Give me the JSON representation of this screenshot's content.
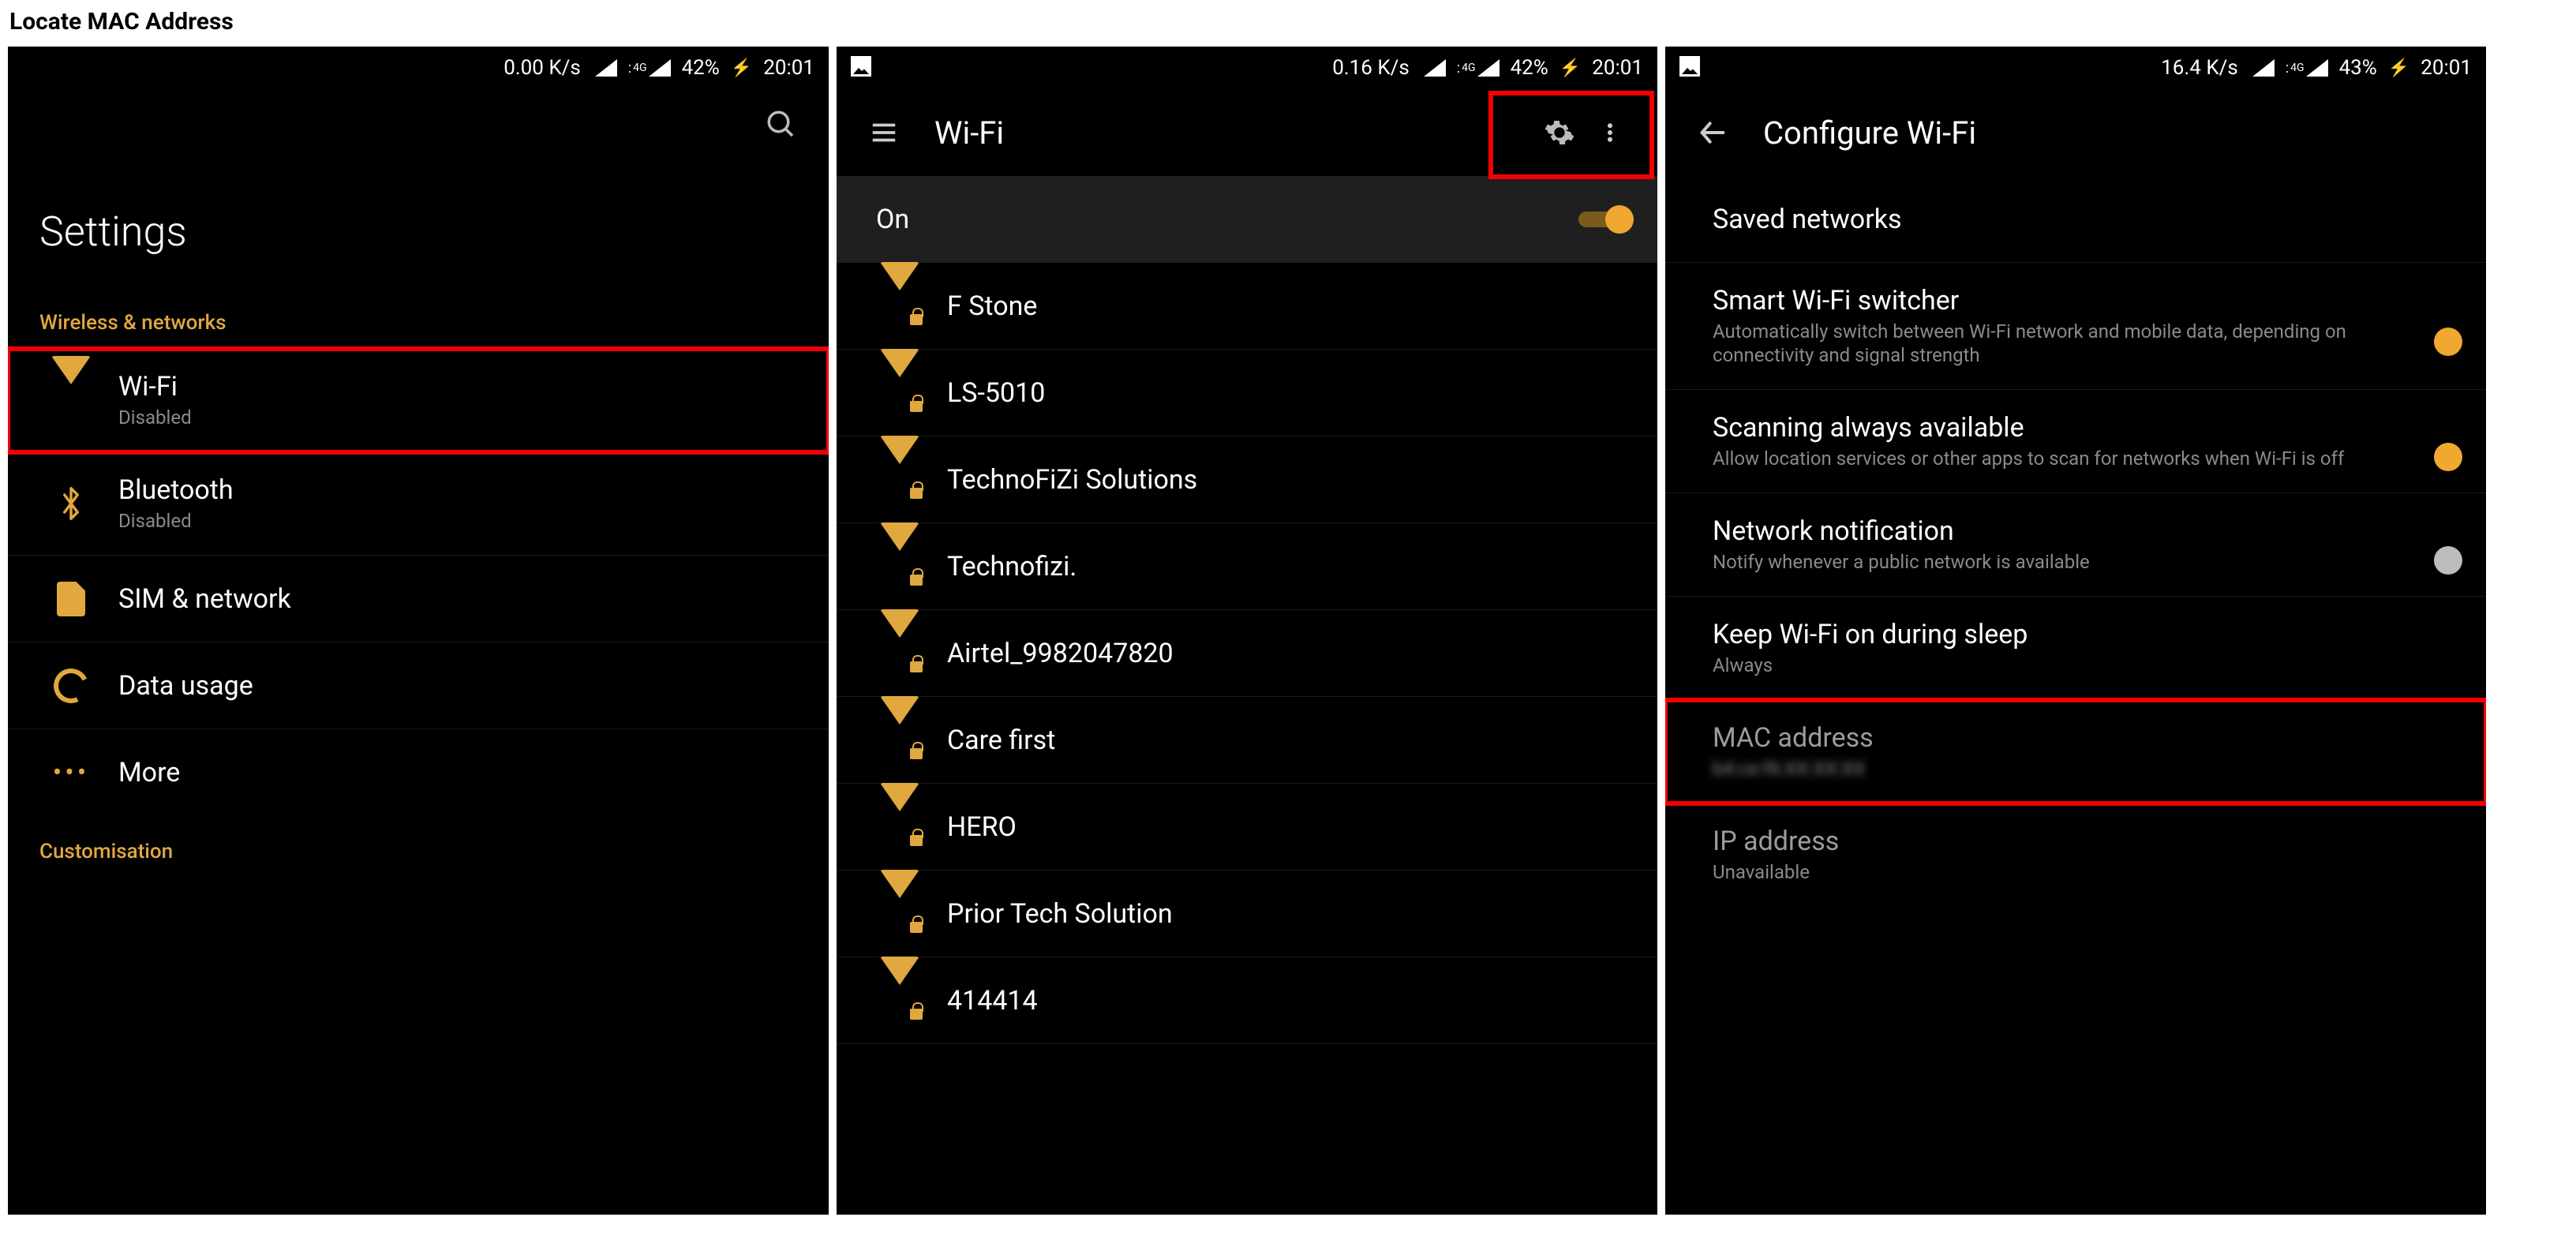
{
  "page_heading": "Locate MAC Address",
  "accent_color": "#e0a83e",
  "screens": {
    "settings": {
      "status": {
        "speed": "0.00 K/s",
        "net_tag": "4G",
        "battery": "42%",
        "time": "20:01"
      },
      "title": "Settings",
      "section_wireless": "Wireless & networks",
      "items": [
        {
          "label": "Wi-Fi",
          "sub": "Disabled",
          "icon": "wifi"
        },
        {
          "label": "Bluetooth",
          "sub": "Disabled",
          "icon": "bluetooth"
        },
        {
          "label": "SIM & network",
          "sub": "",
          "icon": "sim"
        },
        {
          "label": "Data usage",
          "sub": "",
          "icon": "data"
        },
        {
          "label": "More",
          "sub": "",
          "icon": "more"
        }
      ],
      "section_custom": "Customisation"
    },
    "wifi": {
      "status": {
        "speed": "0.16 K/s",
        "net_tag": "4G",
        "battery": "42%",
        "time": "20:01"
      },
      "title": "Wi-Fi",
      "toggle_label": "On",
      "toggle_on": true,
      "networks": [
        "F Stone",
        "LS-5010",
        "TechnoFiZi Solutions",
        "Technofizi.",
        "Airtel_9982047820",
        "Care first",
        "HERO",
        "Prior Tech Solution",
        "414414"
      ]
    },
    "configure": {
      "status": {
        "speed": "16.4 K/s",
        "net_tag": "4G",
        "battery": "43%",
        "time": "20:01"
      },
      "title": "Configure Wi-Fi",
      "rows": {
        "saved": {
          "label": "Saved networks"
        },
        "smart": {
          "label": "Smart Wi-Fi switcher",
          "sub": "Automatically switch between Wi-Fi network and mobile data, depending on connectivity and signal strength",
          "on": true
        },
        "scan": {
          "label": "Scanning always available",
          "sub": "Allow location services or other apps to scan for networks when Wi-Fi is off",
          "on": true
        },
        "notif": {
          "label": "Network notification",
          "sub": "Notify whenever a public network is available",
          "on": false
        },
        "sleep": {
          "label": "Keep Wi-Fi on during sleep",
          "sub": "Always"
        },
        "mac": {
          "label": "MAC address",
          "sub": "b4:ce:f6:XX:XX:XX"
        },
        "ip": {
          "label": "IP address",
          "sub": "Unavailable"
        }
      }
    }
  }
}
